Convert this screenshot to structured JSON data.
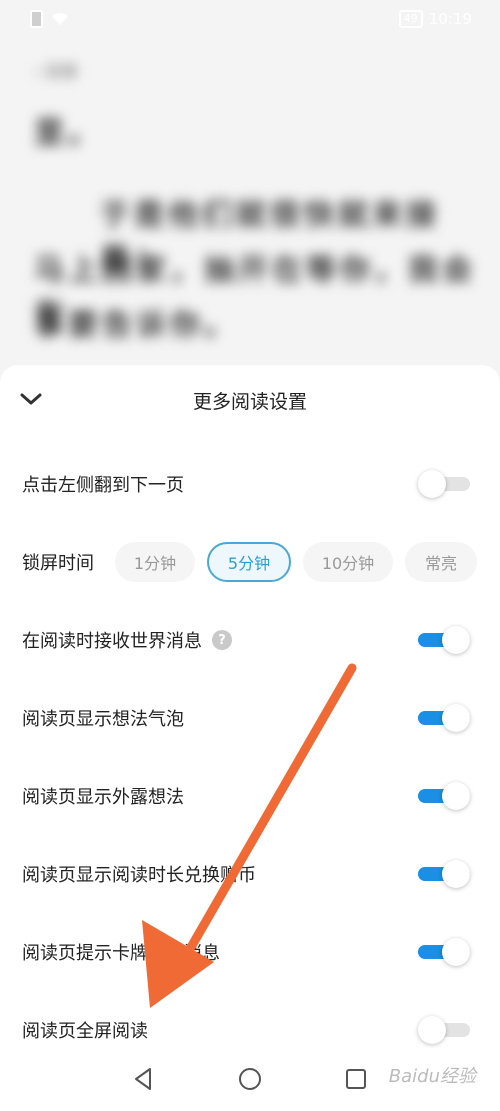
{
  "status_bar": {
    "time": "10:19",
    "battery": "49"
  },
  "reader": {
    "back_label": "目录",
    "lines": [
      "里。",
      "于是他们就很快就来接着：",
      "马上回家，抽开在等你，我会有",
      "事要告诉你。"
    ]
  },
  "sheet": {
    "title": "更多阅读设置",
    "tap_left_next": {
      "label": "点击左侧翻到下一页",
      "enabled": false
    },
    "lock_time": {
      "label": "锁屏时间",
      "options": [
        "1分钟",
        "5分钟",
        "10分钟",
        "常亮"
      ],
      "selected": "5分钟"
    },
    "world_messages": {
      "label": "在阅读时接收世界消息",
      "help": "?",
      "enabled": true
    },
    "idea_bubble": {
      "label": "阅读页显示想法气泡",
      "enabled": true
    },
    "exposed_ideas": {
      "label": "阅读页显示外露想法",
      "enabled": true
    },
    "read_time_coin": {
      "label": "阅读页显示阅读时长兑换赠币",
      "enabled": true
    },
    "card_messages": {
      "label": "阅读页提示卡牌点亮消息",
      "enabled": true
    },
    "fullscreen": {
      "label": "阅读页全屏阅读",
      "enabled": false
    }
  },
  "watermark": "Baidu经验",
  "colors": {
    "toggle_on": "#1a8fe3",
    "chip_selected": "#2a9fd6",
    "arrow": "#f06a35"
  }
}
